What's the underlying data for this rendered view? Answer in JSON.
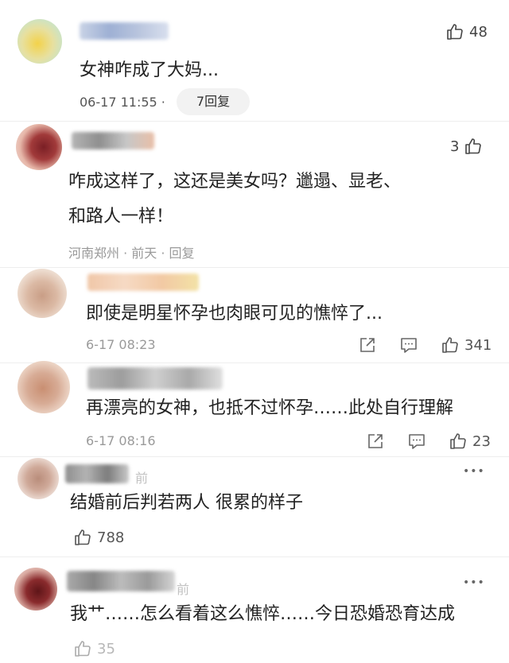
{
  "comments": [
    {
      "text": "女神咋成了大妈...",
      "time": "06-17 11:55 ·",
      "replies": "7回复",
      "likes": "48"
    },
    {
      "text_line1": "咋成这样了，这还是美女吗？邋遢、显老、",
      "text_line2": "和路人一样！",
      "meta": "河南郑州 · 前天 · 回复",
      "likes": "3"
    },
    {
      "text": "即使是明星怀孕也肉眼可见的憔悴了...",
      "time": "6-17 08:23",
      "likes": "341"
    },
    {
      "text": "再漂亮的女神，也抵不过怀孕……此处自行理解",
      "time": "6-17 08:16",
      "likes": "23"
    },
    {
      "text": "结婚前后判若两人 很累的样子",
      "time_fragment": "前",
      "likes": "788"
    },
    {
      "text": "我艹……怎么看着这么憔悴……今日恐婚恐育达成",
      "time_fragment": "前",
      "likes": "35"
    }
  ],
  "icons": {
    "like": "thumbs-up-icon",
    "share": "share-icon",
    "comment": "comment-icon",
    "more": "more-dots-icon"
  },
  "more_dots": "•••"
}
